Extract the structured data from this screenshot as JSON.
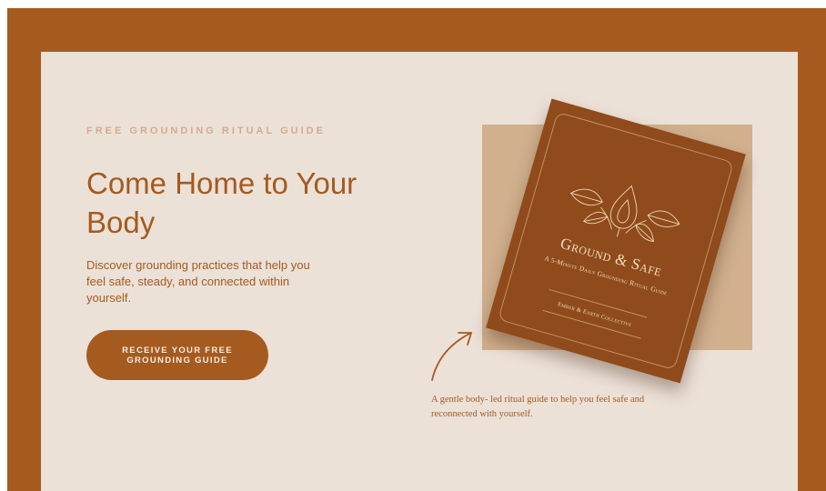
{
  "colors": {
    "frame": "#a55a1f",
    "panel": "#ece1d7",
    "accent": "#a55a1f",
    "eyebrow": "#d4ac8d",
    "tan_block": "#d0b08d",
    "book_cover": "#8f4b1b"
  },
  "hero": {
    "eyebrow": "FREE GROUNDING RITUAL GUIDE",
    "title": "Come Home to Your Body",
    "description": "Discover grounding practices that help you feel safe, steady, and connected within yourself.",
    "cta_label": "RECEIVE YOUR FREE GROUNDING GUIDE"
  },
  "book": {
    "title": "Ground & Safe",
    "subtitle": "A 5-Minute Daily Grounding Ritual Guide",
    "author": "Ember & Earth Collective",
    "art_icon": "leaves-and-drop-icon"
  },
  "caption": {
    "icon": "curved-arrow-icon",
    "text": "A gentle body- led ritual guide to help you feel safe and reconnected with yourself."
  }
}
